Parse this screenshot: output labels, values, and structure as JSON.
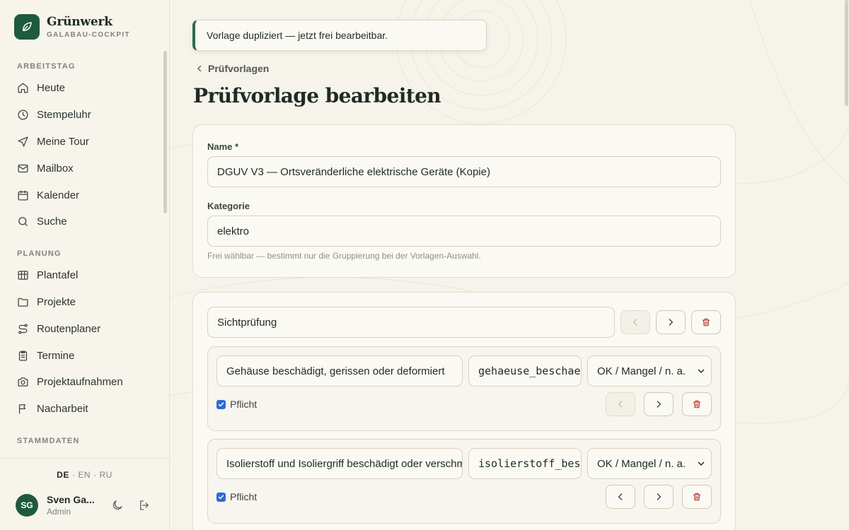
{
  "brand": {
    "name": "Grünwerk",
    "subtitle": "GALABAU-COCKPIT"
  },
  "sidebar": {
    "sections": [
      {
        "title": "ARBEITSTAG",
        "items": [
          {
            "label": "Heute",
            "icon": "home-icon"
          },
          {
            "label": "Stempeluhr",
            "icon": "clock-icon"
          },
          {
            "label": "Meine Tour",
            "icon": "navigation-icon"
          },
          {
            "label": "Mailbox",
            "icon": "mail-icon"
          },
          {
            "label": "Kalender",
            "icon": "calendar-icon"
          },
          {
            "label": "Suche",
            "icon": "search-icon"
          }
        ]
      },
      {
        "title": "PLANUNG",
        "items": [
          {
            "label": "Plantafel",
            "icon": "board-icon"
          },
          {
            "label": "Projekte",
            "icon": "folder-icon"
          },
          {
            "label": "Routenplaner",
            "icon": "route-icon"
          },
          {
            "label": "Termine",
            "icon": "clipboard-icon"
          },
          {
            "label": "Projektaufnahmen",
            "icon": "camera-icon"
          },
          {
            "label": "Nacharbeit",
            "icon": "flag-icon"
          }
        ]
      },
      {
        "title": "STAMMDATEN",
        "items": []
      }
    ],
    "languages": [
      "DE",
      "EN",
      "RU"
    ],
    "active_language": "DE",
    "user": {
      "initials": "SG",
      "name": "Sven Ga...",
      "role": "Admin"
    }
  },
  "toast": {
    "message": "Vorlage dupliziert — jetzt frei bearbeitbar."
  },
  "breadcrumb": {
    "label": "Prüfvorlagen"
  },
  "page": {
    "title": "Prüfvorlage bearbeiten"
  },
  "form": {
    "name_label": "Name *",
    "name_value": "DGUV V3 — Ortsveränderliche elektrische Geräte (Kopie)",
    "category_label": "Kategorie",
    "category_value": "elektro",
    "category_hint": "Frei wählbar — bestimmt nur die Gruppierung bei der Vorlagen-Auswahl."
  },
  "section": {
    "title_value": "Sichtprüfung",
    "items": [
      {
        "label": "Gehäuse beschädigt, gerissen oder deformiert",
        "key": "gehaeuse_beschaedigt",
        "type": "OK / Mangel / n. a.",
        "required_label": "Pflicht",
        "required": true
      },
      {
        "label": "Isolierstoff und Isoliergriff beschädigt oder verschmort",
        "key": "isolierstoff_beschaedigt",
        "type": "OK / Mangel / n. a.",
        "required_label": "Pflicht",
        "required": true
      }
    ]
  },
  "colors": {
    "brand": "#1f5a3e",
    "accent": "#2e6b4a",
    "danger": "#b5392f",
    "checkbox": "#2c6bd6"
  }
}
